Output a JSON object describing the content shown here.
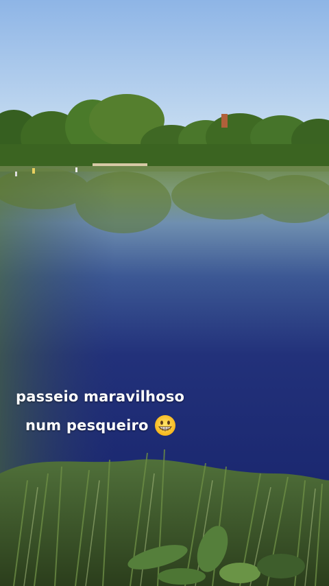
{
  "caption": {
    "line1": "passeio maravilhoso",
    "line2": "num pesqueiro",
    "emoji": "grinning-face-emoji"
  },
  "colors": {
    "sky_top": "#8fb7e6",
    "sky_bottom": "#cfe3f3",
    "foliage": "#3f6b22",
    "water_dark": "#1c2a72",
    "grass": "#4b6a2a"
  }
}
